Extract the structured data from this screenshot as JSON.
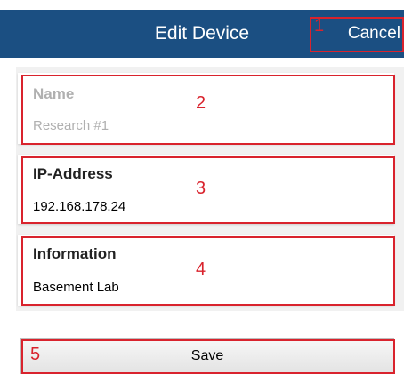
{
  "header": {
    "title": "Edit Device",
    "cancel_label": "Cancel"
  },
  "form": {
    "name": {
      "label": "Name",
      "placeholder": "Research #1"
    },
    "ip": {
      "label": "IP-Address",
      "value": "192.168.178.24"
    },
    "info": {
      "label": "Information",
      "value": "Basement Lab"
    }
  },
  "save_label": "Save",
  "annotations": [
    "1",
    "2",
    "3",
    "4",
    "5"
  ],
  "colors": {
    "header_bg": "#1b4f82",
    "annotation": "#d9232d",
    "label_disabled": "#b0b0b0",
    "background_panel": "#f1f1f1"
  }
}
